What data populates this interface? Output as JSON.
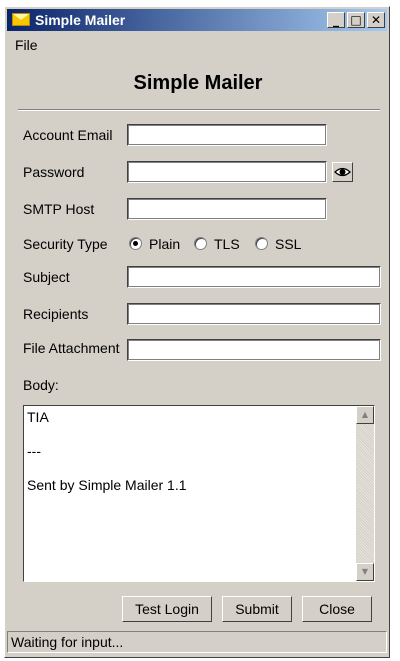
{
  "window": {
    "title": "Simple Mailer",
    "minimize_glyph": "_",
    "maximize_glyph": "□",
    "close_glyph": "✕"
  },
  "menu": {
    "file_label": "File"
  },
  "heading": "Simple Mailer",
  "form": {
    "account_email_label": "Account Email",
    "account_email_value": "",
    "password_label": "Password",
    "password_value": "",
    "smtp_host_label": "SMTP Host",
    "smtp_host_value": "",
    "security_type_label": "Security Type",
    "security_options": [
      "Plain",
      "TLS",
      "SSL"
    ],
    "security_selected": "Plain",
    "subject_label": "Subject",
    "subject_value": "",
    "recipients_label": "Recipients",
    "recipients_value": "",
    "attachment_label": "File Attachment",
    "attachment_value": "",
    "body_label": "Body:",
    "body_lines": [
      "TIA",
      "---",
      "Sent by Simple Mailer 1.1"
    ]
  },
  "buttons": {
    "test_login": "Test Login",
    "submit": "Submit",
    "close": "Close"
  },
  "status": "Waiting for input..."
}
